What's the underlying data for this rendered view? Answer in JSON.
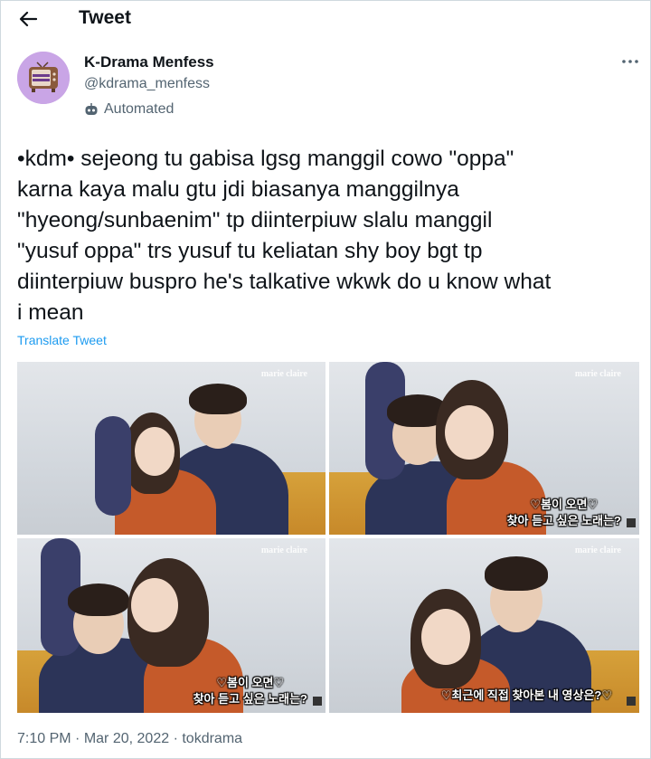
{
  "header": {
    "title": "Tweet",
    "back_icon": "arrow-left-icon"
  },
  "author": {
    "display_name": "K-Drama Menfess",
    "handle": "@kdrama_menfess",
    "automated_label": "Automated",
    "avatar_text": "KDRAMA MENFESS",
    "avatar_color": "#c9a5e6"
  },
  "tweet": {
    "text": "•kdm• sejeong tu gabisa lgsg manggil cowo \"oppa\"\nkarna kaya malu gtu jdi biasanya manggilnya\n\"hyeong/sunbaenim\" tp diinterpiuw slalu manggil\n\"yusuf oppa\" trs yusuf tu keliatan shy boy bgt tp\ndiinterpiuw buspro he's talkative wkwk do u know what\ni mean",
    "translate_label": "Translate Tweet"
  },
  "media": {
    "watermark": "marie claire",
    "photos": [
      {
        "caption_line1": "",
        "caption_line2": ""
      },
      {
        "caption_line1": "♡봄이 오면♡",
        "caption_line2": "찾아 듣고 싶은 노래는?"
      },
      {
        "caption_line1": "♡봄이 오면♡",
        "caption_line2": "찾아 듣고 싶은 노래는?"
      },
      {
        "caption_line1": "♡최근에 직접 찾아본 내 영상은?♡",
        "caption_line2": ""
      }
    ]
  },
  "meta": {
    "time": "7:10 PM",
    "date": "Mar 20, 2022",
    "source": "tokdrama",
    "separator": "·"
  },
  "colors": {
    "link": "#1d9bf0",
    "secondary_text": "#536471",
    "sofa": "#d6a13a"
  }
}
